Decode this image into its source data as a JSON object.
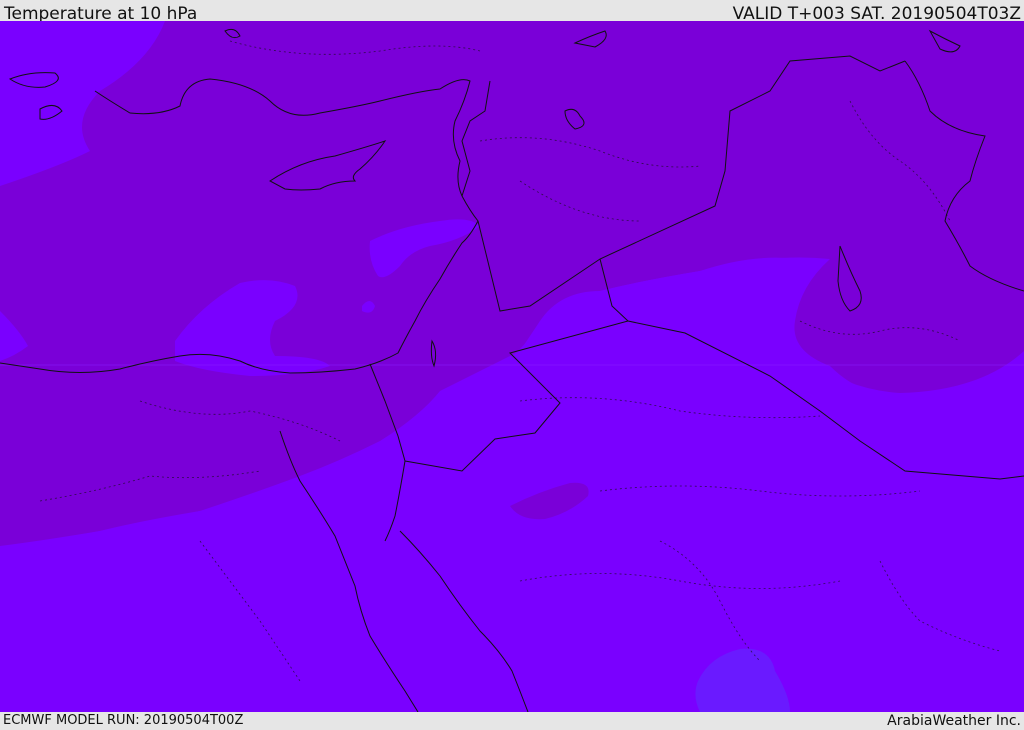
{
  "header": {
    "title": "Temperature at 10 hPa",
    "valid": "VALID T+003 SAT. 20190504T03Z"
  },
  "footer": {
    "model_run": "ECMWF MODEL RUN: 20190504T00Z",
    "credit": "ArabiaWeather Inc."
  },
  "colors": {
    "warm_band": "#7a00d8",
    "mid_band": "#7a00ff",
    "cool_patch": "#6a1aff",
    "coastline": "#111111"
  }
}
